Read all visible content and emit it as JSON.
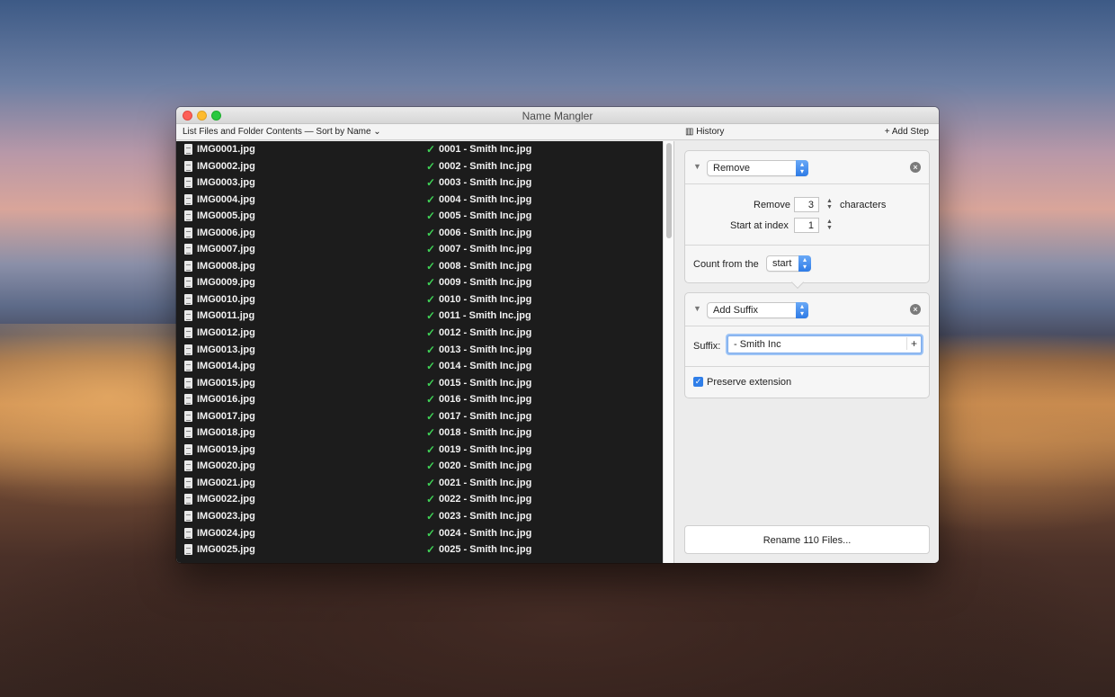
{
  "window": {
    "title": "Name Mangler"
  },
  "toolbar": {
    "list_label": "List Files and Folder Contents — Sort by Name ⌄",
    "history_icon": "▥",
    "history_label": "History",
    "add_step_label": "+ Add Step"
  },
  "files": [
    {
      "original": "IMG0001.jpg",
      "renamed": "0001 - Smith Inc.jpg"
    },
    {
      "original": "IMG0002.jpg",
      "renamed": "0002 - Smith Inc.jpg"
    },
    {
      "original": "IMG0003.jpg",
      "renamed": "0003 - Smith Inc.jpg"
    },
    {
      "original": "IMG0004.jpg",
      "renamed": "0004 - Smith Inc.jpg"
    },
    {
      "original": "IMG0005.jpg",
      "renamed": "0005 - Smith Inc.jpg"
    },
    {
      "original": "IMG0006.jpg",
      "renamed": "0006 - Smith Inc.jpg"
    },
    {
      "original": "IMG0007.jpg",
      "renamed": "0007 - Smith Inc.jpg"
    },
    {
      "original": "IMG0008.jpg",
      "renamed": "0008 - Smith Inc.jpg"
    },
    {
      "original": "IMG0009.jpg",
      "renamed": "0009 - Smith Inc.jpg"
    },
    {
      "original": "IMG0010.jpg",
      "renamed": "0010 - Smith Inc.jpg"
    },
    {
      "original": "IMG0011.jpg",
      "renamed": "0011 - Smith Inc.jpg"
    },
    {
      "original": "IMG0012.jpg",
      "renamed": "0012 - Smith Inc.jpg"
    },
    {
      "original": "IMG0013.jpg",
      "renamed": "0013 - Smith Inc.jpg"
    },
    {
      "original": "IMG0014.jpg",
      "renamed": "0014 - Smith Inc.jpg"
    },
    {
      "original": "IMG0015.jpg",
      "renamed": "0015 - Smith Inc.jpg"
    },
    {
      "original": "IMG0016.jpg",
      "renamed": "0016 - Smith Inc.jpg"
    },
    {
      "original": "IMG0017.jpg",
      "renamed": "0017 - Smith Inc.jpg"
    },
    {
      "original": "IMG0018.jpg",
      "renamed": "0018 - Smith Inc.jpg"
    },
    {
      "original": "IMG0019.jpg",
      "renamed": "0019 - Smith Inc.jpg"
    },
    {
      "original": "IMG0020.jpg",
      "renamed": "0020 - Smith Inc.jpg"
    },
    {
      "original": "IMG0021.jpg",
      "renamed": "0021 - Smith Inc.jpg"
    },
    {
      "original": "IMG0022.jpg",
      "renamed": "0022 - Smith Inc.jpg"
    },
    {
      "original": "IMG0023.jpg",
      "renamed": "0023 - Smith Inc.jpg"
    },
    {
      "original": "IMG0024.jpg",
      "renamed": "0024 - Smith Inc.jpg"
    },
    {
      "original": "IMG0025.jpg",
      "renamed": "0025 - Smith Inc.jpg"
    }
  ],
  "steps": {
    "remove": {
      "type": "Remove",
      "remove_label": "Remove",
      "remove_count": "3",
      "characters_label": "characters",
      "start_label": "Start at index",
      "start_index": "1",
      "count_from_label": "Count from the",
      "count_from_value": "start"
    },
    "suffix": {
      "type": "Add Suffix",
      "suffix_label": "Suffix:",
      "suffix_value": "- Smith Inc",
      "plus_label": "+",
      "preserve_label": "Preserve extension",
      "preserve_checked": true
    }
  },
  "rename_button": "Rename 110 Files...",
  "colors": {
    "accent": "#2f7ee8",
    "check": "#3fd256",
    "list_bg": "#1c1c1c"
  },
  "icons": {
    "file": "document-icon",
    "status": "checkmark-icon",
    "close": "close-circle-icon"
  }
}
